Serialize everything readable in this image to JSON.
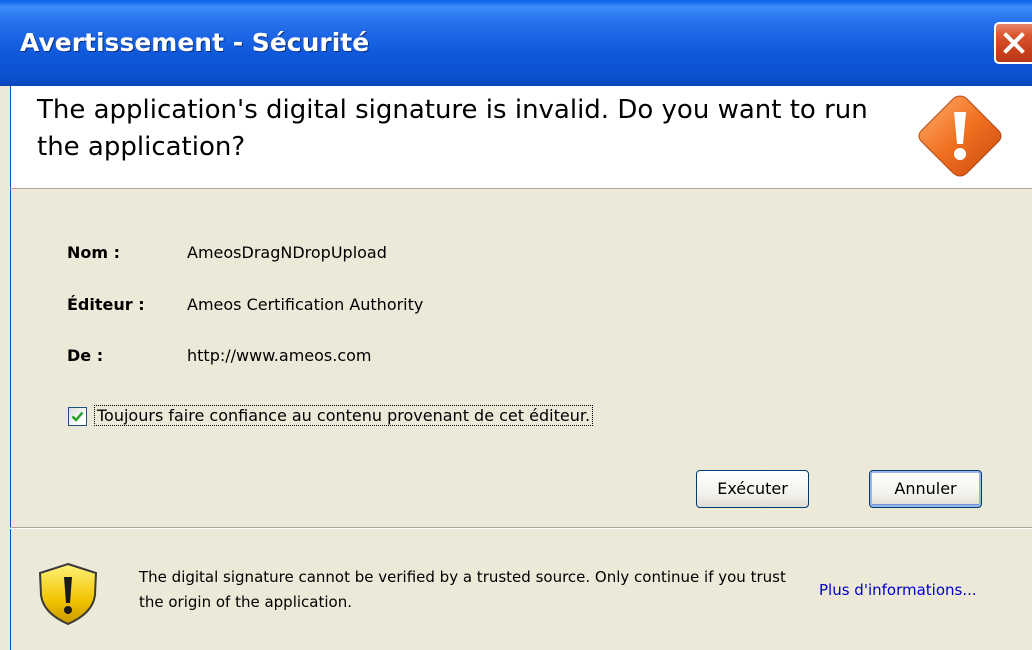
{
  "window": {
    "title": "Avertissement - Sécurité"
  },
  "header": {
    "headline": "The application's digital signature is invalid.  Do you want to run the application?",
    "icon": "warning-diamond-icon"
  },
  "details": {
    "name_label": "Nom :",
    "name_value": "AmeosDragNDropUpload",
    "publisher_label": "Éditeur :",
    "publisher_value": "Ameos Certification Authority",
    "from_label": "De :",
    "from_value": "http://www.ameos.com"
  },
  "trust_checkbox": {
    "label": "Toujours faire confiance au contenu provenant de cet éditeur.",
    "checked": true
  },
  "buttons": {
    "run_label": "Exécuter",
    "cancel_label": "Annuler"
  },
  "footer": {
    "message": "The digital signature cannot be verified by a trusted source.  Only continue if you trust the origin of the application.",
    "more_info_label": "Plus d'informations...",
    "icon": "warning-shield-icon"
  },
  "colors": {
    "titlebar": "#0c51cf",
    "dialog_bg": "#ece9d8",
    "warning_orange": "#f07020",
    "link": "#0000cc"
  }
}
